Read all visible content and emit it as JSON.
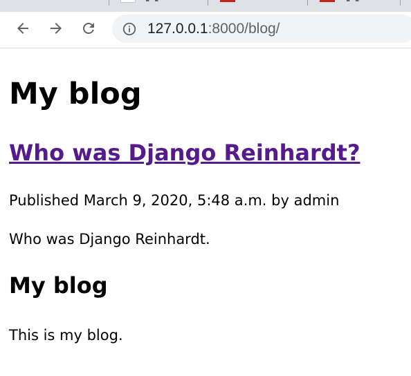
{
  "browser": {
    "address_host": "127.0.0.1",
    "address_path": ":8000/blog/",
    "icons": {
      "back": "back-arrow-icon",
      "forward": "forward-arrow-icon",
      "reload": "reload-icon",
      "site_info": "info-icon"
    }
  },
  "page": {
    "title": "My blog",
    "posts": [
      {
        "title": "Who was Django Reinhardt?",
        "meta": "Published March 9, 2020, 5:48 a.m. by admin",
        "body": "Who was Django Reinhardt."
      }
    ],
    "section": {
      "title": "My blog",
      "body": "This is my blog."
    }
  },
  "colors": {
    "visited_link": "#551a8b",
    "tabstrip": "#dee1e6",
    "omnibox": "#f1f3f4",
    "icon": "#5f6368"
  }
}
